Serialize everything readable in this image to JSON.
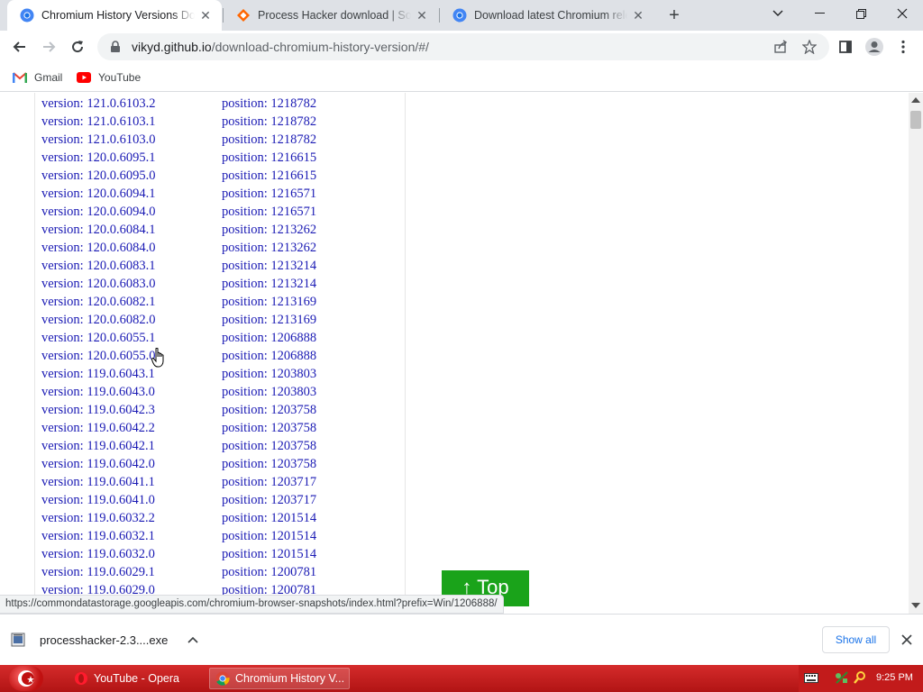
{
  "browser": {
    "tabs": [
      {
        "title": "Chromium History Versions Dow",
        "active": true,
        "favicon": "chromium-icon"
      },
      {
        "title": "Process Hacker download | Sourc",
        "active": false,
        "favicon": "sourceforge-icon"
      },
      {
        "title": "Download latest Chromium relea",
        "active": false,
        "favicon": "chromium-icon"
      }
    ],
    "new_tab_label": "+",
    "url": {
      "host": "vikyd.github.io",
      "path": "/download-chromium-history-version/#/"
    },
    "bookmarks": [
      {
        "label": "Gmail",
        "icon": "gmail-icon"
      },
      {
        "label": "YouTube",
        "icon": "youtube-icon"
      }
    ]
  },
  "page": {
    "version_prefix": "version:",
    "position_prefix": "position:",
    "rows": [
      {
        "version": "121.0.6103.2",
        "position": "1218782"
      },
      {
        "version": "121.0.6103.1",
        "position": "1218782"
      },
      {
        "version": "121.0.6103.0",
        "position": "1218782"
      },
      {
        "version": "120.0.6095.1",
        "position": "1216615"
      },
      {
        "version": "120.0.6095.0",
        "position": "1216615"
      },
      {
        "version": "120.0.6094.1",
        "position": "1216571"
      },
      {
        "version": "120.0.6094.0",
        "position": "1216571"
      },
      {
        "version": "120.0.6084.1",
        "position": "1213262"
      },
      {
        "version": "120.0.6084.0",
        "position": "1213262"
      },
      {
        "version": "120.0.6083.1",
        "position": "1213214"
      },
      {
        "version": "120.0.6083.0",
        "position": "1213214"
      },
      {
        "version": "120.0.6082.1",
        "position": "1213169"
      },
      {
        "version": "120.0.6082.0",
        "position": "1213169"
      },
      {
        "version": "120.0.6055.1",
        "position": "1206888"
      },
      {
        "version": "120.0.6055.0",
        "position": "1206888"
      },
      {
        "version": "119.0.6043.1",
        "position": "1203803"
      },
      {
        "version": "119.0.6043.0",
        "position": "1203803"
      },
      {
        "version": "119.0.6042.3",
        "position": "1203758"
      },
      {
        "version": "119.0.6042.2",
        "position": "1203758"
      },
      {
        "version": "119.0.6042.1",
        "position": "1203758"
      },
      {
        "version": "119.0.6042.0",
        "position": "1203758"
      },
      {
        "version": "119.0.6041.1",
        "position": "1203717"
      },
      {
        "version": "119.0.6041.0",
        "position": "1203717"
      },
      {
        "version": "119.0.6032.2",
        "position": "1201514"
      },
      {
        "version": "119.0.6032.1",
        "position": "1201514"
      },
      {
        "version": "119.0.6032.0",
        "position": "1201514"
      },
      {
        "version": "119.0.6029.1",
        "position": "1200781"
      },
      {
        "version": "119.0.6029.0",
        "position": "1200781"
      }
    ],
    "top_button_label": "↑ Top",
    "status_url": "https://commondatastorage.googleapis.com/chromium-browser-snapshots/index.html?prefix=Win/1206888/"
  },
  "downloads": {
    "file_name": "processhacker-2.3....exe",
    "show_all_label": "Show all"
  },
  "taskbar": {
    "tasks": [
      {
        "label": "YouTube - Opera",
        "icon": "opera-icon",
        "active": false
      },
      {
        "label": "Chromium History V...",
        "icon": "chrome-icon",
        "active": true
      }
    ],
    "clock": "9:25 PM"
  },
  "colors": {
    "link": "#1a1ab4",
    "top_button": "#1aa31a",
    "taskbar": "#c21b1b",
    "tabstrip": "#dee1e6"
  }
}
